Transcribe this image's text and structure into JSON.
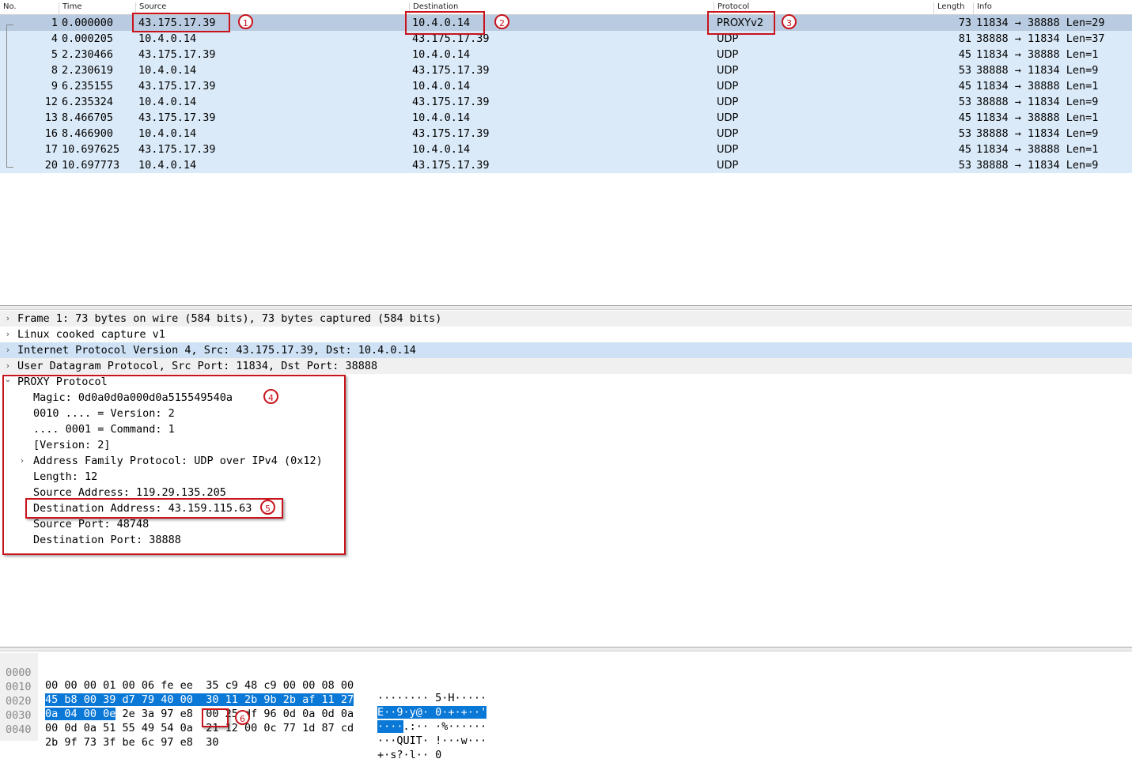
{
  "packet_list": {
    "columns": {
      "no": "No.",
      "time": "Time",
      "source": "Source",
      "destination": "Destination",
      "protocol": "Protocol",
      "length": "Length",
      "info": "Info"
    },
    "rows": [
      {
        "no": "1",
        "time": "0.000000",
        "source": "43.175.17.39",
        "destination": "10.4.0.14",
        "protocol": "PROXYv2",
        "length": "73",
        "info": "11834 → 38888 Len=29",
        "selected": true
      },
      {
        "no": "4",
        "time": "0.000205",
        "source": "10.4.0.14",
        "destination": "43.175.17.39",
        "protocol": "UDP",
        "length": "81",
        "info": "38888 → 11834 Len=37"
      },
      {
        "no": "5",
        "time": "2.230466",
        "source": "43.175.17.39",
        "destination": "10.4.0.14",
        "protocol": "UDP",
        "length": "45",
        "info": "11834 → 38888 Len=1"
      },
      {
        "no": "8",
        "time": "2.230619",
        "source": "10.4.0.14",
        "destination": "43.175.17.39",
        "protocol": "UDP",
        "length": "53",
        "info": "38888 → 11834 Len=9"
      },
      {
        "no": "9",
        "time": "6.235155",
        "source": "43.175.17.39",
        "destination": "10.4.0.14",
        "protocol": "UDP",
        "length": "45",
        "info": "11834 → 38888 Len=1"
      },
      {
        "no": "12",
        "time": "6.235324",
        "source": "10.4.0.14",
        "destination": "43.175.17.39",
        "protocol": "UDP",
        "length": "53",
        "info": "38888 → 11834 Len=9"
      },
      {
        "no": "13",
        "time": "8.466705",
        "source": "43.175.17.39",
        "destination": "10.4.0.14",
        "protocol": "UDP",
        "length": "45",
        "info": "11834 → 38888 Len=1"
      },
      {
        "no": "16",
        "time": "8.466900",
        "source": "10.4.0.14",
        "destination": "43.175.17.39",
        "protocol": "UDP",
        "length": "53",
        "info": "38888 → 11834 Len=9"
      },
      {
        "no": "17",
        "time": "10.697625",
        "source": "43.175.17.39",
        "destination": "10.4.0.14",
        "protocol": "UDP",
        "length": "45",
        "info": "11834 → 38888 Len=1"
      },
      {
        "no": "20",
        "time": "10.697773",
        "source": "10.4.0.14",
        "destination": "43.175.17.39",
        "protocol": "UDP",
        "length": "53",
        "info": "38888 → 11834 Len=9"
      }
    ]
  },
  "details": {
    "arrows": {
      "collapsed": "›",
      "expanded": "⌄"
    },
    "frame": "Frame 1: 73 bytes on wire (584 bits), 73 bytes captured (584 bits)",
    "linux_cooked": "Linux cooked capture v1",
    "ip": "Internet Protocol Version 4, Src: 43.175.17.39, Dst: 10.4.0.14",
    "udp": "User Datagram Protocol, Src Port: 11834, Dst Port: 38888",
    "proxy": {
      "title": "PROXY Protocol",
      "fields": [
        "Magic: 0d0a0d0a000d0a515549540a",
        "0010 .... = Version: 2",
        ".... 0001 = Command: 1",
        "[Version: 2]",
        "Address Family Protocol: UDP over IPv4 (0x12)",
        "Length: 12",
        "Source Address: 119.29.135.205",
        "Destination Address: 43.159.115.63",
        "Source Port: 48748",
        "Destination Port: 38888"
      ]
    }
  },
  "bytes": {
    "rows": [
      {
        "offset": "0000",
        "hex": [
          "00 00 00 01 00 06 fe ee  35 c9 48 c9 00 00 08 00"
        ],
        "ascii": [
          "········ 5·H·····"
        ]
      },
      {
        "offset": "0010",
        "hex_sel": "45 b8 00 39 d7 79 40 00  30 11 2b 9b 2b af 11 27",
        "ascii_sel": "E··9·y@· 0·+·+··'"
      },
      {
        "offset": "0020",
        "hex_sel": "0a 04 00 0e",
        "hex_rest": " 2e 3a 97 e8  00 25 df 96 0d 0a 0d 0a",
        "ascii_sel": "····",
        "ascii_rest": ".:·· ·%······"
      },
      {
        "offset": "0030",
        "hex_rest": "00 0d 0a 51 55 49 54 0a  21 12 00 0c 77 1d 87 cd",
        "ascii_rest": "···QUIT· !···w···"
      },
      {
        "offset": "0040",
        "hex_rest": "2b 9f 73 3f be 6c 97 e8  30",
        "ascii_rest": "+·s?·l·· 0"
      }
    ]
  },
  "annotations": [
    "1",
    "2",
    "3",
    "4",
    "5",
    "6"
  ],
  "colors": {
    "row_bg": "#dbeaf8",
    "row_selected": "#b9cbe0",
    "annotation_red": "#c8141c",
    "byte_highlight": "#0a78d6"
  }
}
